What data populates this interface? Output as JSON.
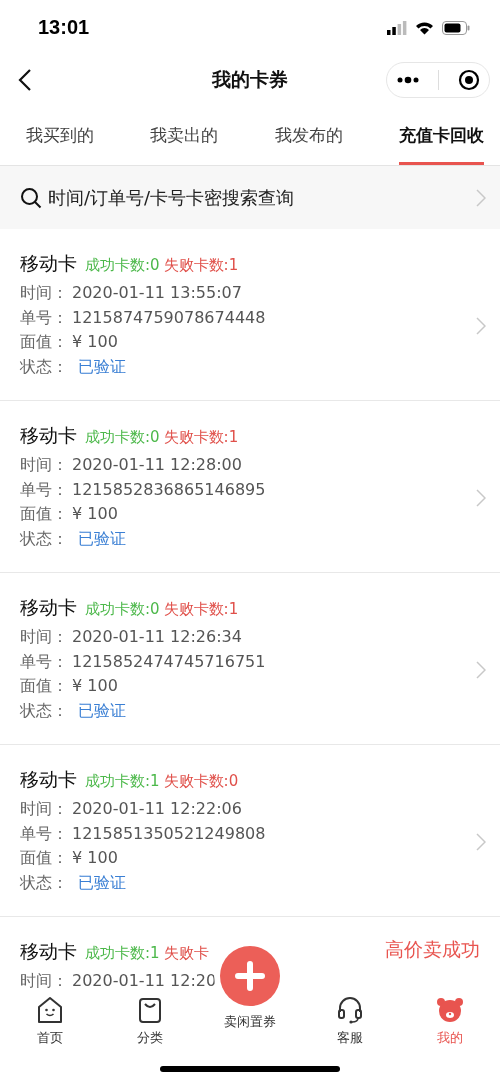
{
  "status_bar": {
    "time": "13:01"
  },
  "nav": {
    "title": "我的卡券"
  },
  "tabs": [
    {
      "label": "我买到的",
      "selected": false
    },
    {
      "label": "我卖出的",
      "selected": false
    },
    {
      "label": "我发布的",
      "selected": false
    },
    {
      "label": "充值卡回收",
      "selected": true
    }
  ],
  "search": {
    "placeholder": "时间/订单号/卡号卡密搜索查询"
  },
  "cards": [
    {
      "title": "移动卡",
      "success": "成功卡数:0",
      "fail": "失败卡数:1",
      "rows": [
        {
          "label": "时间：",
          "value": "2020-01-11 13:55:07"
        },
        {
          "label": "单号：",
          "value": "1215874759078674448"
        },
        {
          "label": "面值：",
          "value": "¥ 100"
        },
        {
          "label": "状态：",
          "value": "已验证",
          "kind": "status"
        }
      ]
    },
    {
      "title": "移动卡",
      "success": "成功卡数:0",
      "fail": "失败卡数:1",
      "rows": [
        {
          "label": "时间：",
          "value": "2020-01-11 12:28:00"
        },
        {
          "label": "单号：",
          "value": "1215852836865146895"
        },
        {
          "label": "面值：",
          "value": "¥ 100"
        },
        {
          "label": "状态：",
          "value": "已验证",
          "kind": "status"
        }
      ]
    },
    {
      "title": "移动卡",
      "success": "成功卡数:0",
      "fail": "失败卡数:1",
      "rows": [
        {
          "label": "时间：",
          "value": "2020-01-11 12:26:34"
        },
        {
          "label": "单号：",
          "value": "1215852474745716751"
        },
        {
          "label": "面值：",
          "value": "¥ 100"
        },
        {
          "label": "状态：",
          "value": "已验证",
          "kind": "status"
        }
      ]
    },
    {
      "title": "移动卡",
      "success": "成功卡数:1",
      "fail": "失败卡数:0",
      "rows": [
        {
          "label": "时间：",
          "value": "2020-01-11 12:22:06"
        },
        {
          "label": "单号：",
          "value": "1215851350521249808"
        },
        {
          "label": "面值：",
          "value": "¥ 100"
        },
        {
          "label": "状态：",
          "value": "已验证",
          "kind": "status"
        }
      ]
    },
    {
      "title": "移动卡",
      "success": "成功卡数:1",
      "fail": "失败卡",
      "notice": "高价卖成功",
      "rows": [
        {
          "label": "时间：",
          "value": "2020-01-11 12:20"
        }
      ]
    }
  ],
  "tab_bar": [
    {
      "label": "首页",
      "kind": "home",
      "selected": false
    },
    {
      "label": "分类",
      "kind": "bag",
      "selected": false
    },
    {
      "label": "卖闲置券",
      "kind": "plus",
      "selected": false
    },
    {
      "label": "客服",
      "kind": "headset",
      "selected": false
    },
    {
      "label": "我的",
      "kind": "bear",
      "selected": true
    }
  ]
}
